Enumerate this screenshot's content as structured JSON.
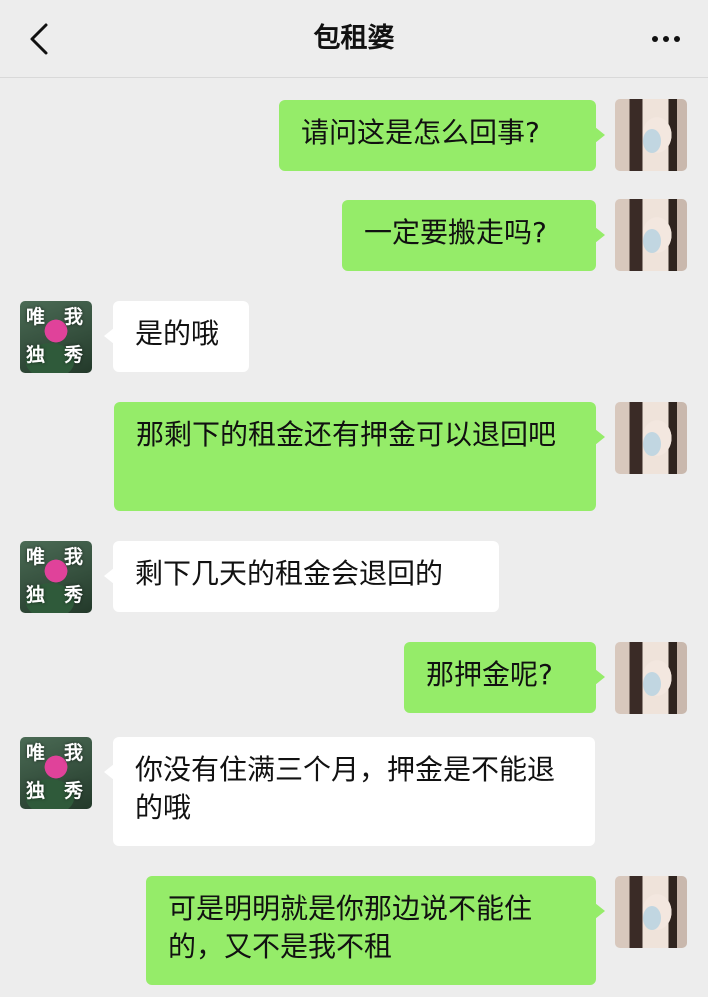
{
  "header": {
    "title": "包租婆"
  },
  "her_avatar": {
    "chars": [
      "唯",
      "我",
      "独",
      "秀"
    ]
  },
  "messages": [
    {
      "from": "me",
      "text": "请问这是怎么回事?"
    },
    {
      "from": "me",
      "text": "一定要搬走吗?"
    },
    {
      "from": "her",
      "text": "是的哦"
    },
    {
      "from": "me",
      "text": "那剩下的租金还有押金可以退回吧"
    },
    {
      "from": "her",
      "text": "剩下几天的租金会退回的"
    },
    {
      "from": "me",
      "text": "那押金呢?"
    },
    {
      "from": "her",
      "text": "你没有住满三个月，押金是不能退的哦"
    },
    {
      "from": "me",
      "text": "可是明明就是你那边说不能住的，又不是我不租"
    }
  ]
}
